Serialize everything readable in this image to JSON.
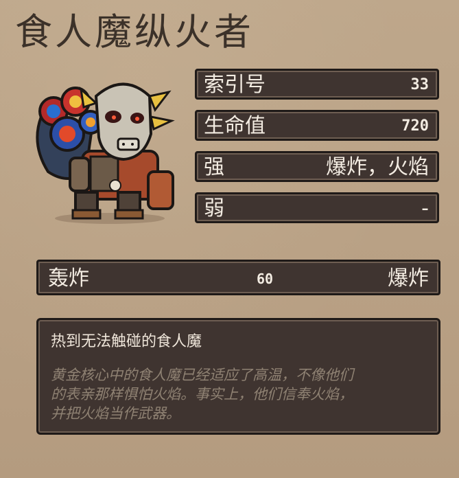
{
  "monster": {
    "name": "食人魔纵火者",
    "portrait_icon": "ogre-arsonist-sprite"
  },
  "stats": [
    {
      "label": "索引号",
      "value": "33"
    },
    {
      "label": "生命值",
      "value": "720"
    },
    {
      "label": "强",
      "value": "爆炸，火焰"
    },
    {
      "label": "弱",
      "value": "-"
    }
  ],
  "attack": {
    "name": "轰炸",
    "damage": "60",
    "element": "爆炸"
  },
  "description": {
    "title": "热到无法触碰的食人魔",
    "lines": [
      "黄金核心中的食人魔已经适应了高温，不像他们",
      "的表亲那样惧怕火焰。事实上，他们信奉火焰，",
      "并把火焰当作武器。"
    ]
  }
}
